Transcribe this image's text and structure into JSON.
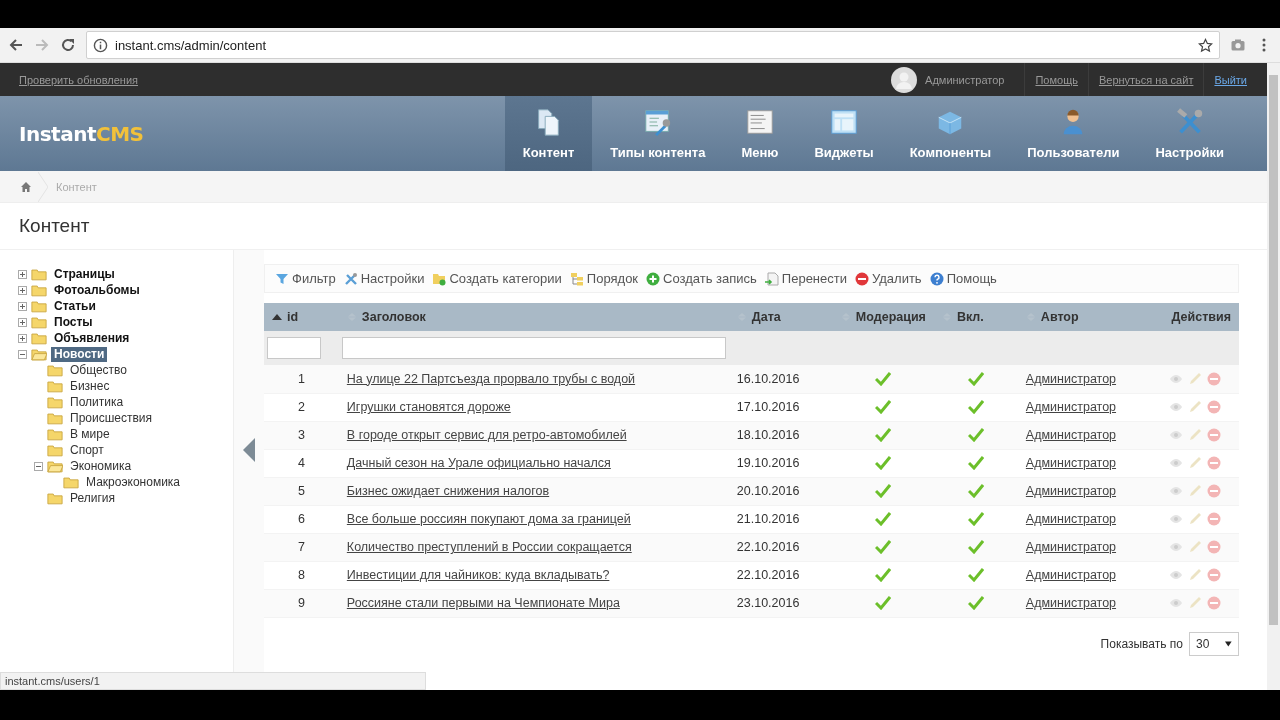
{
  "browser": {
    "url": "instant.cms/admin/content"
  },
  "admin_bar": {
    "update_link": "Проверить обновления",
    "user": "Администратор",
    "links": [
      {
        "label": "Помощь",
        "kind": "plain"
      },
      {
        "label": "Вернуться на сайт",
        "kind": "plain"
      },
      {
        "label": "Выйти",
        "kind": "accent"
      }
    ]
  },
  "header": {
    "logo_part_1": "Instant",
    "logo_part_2": "CMS",
    "nav": [
      {
        "label": "Контент",
        "kind": "content",
        "selected": true
      },
      {
        "label": "Типы контента",
        "kind": "types",
        "selected": false
      },
      {
        "label": "Меню",
        "kind": "menu",
        "selected": false
      },
      {
        "label": "Виджеты",
        "kind": "widgets",
        "selected": false
      },
      {
        "label": "Компоненты",
        "kind": "components",
        "selected": false
      },
      {
        "label": "Пользователи",
        "kind": "users",
        "selected": false
      },
      {
        "label": "Настройки",
        "kind": "settings",
        "selected": false
      }
    ]
  },
  "breadcrumb": [
    "Контент"
  ],
  "page_title": "Контент",
  "tree": [
    {
      "label": "Страницы",
      "expanded": false,
      "selected": false
    },
    {
      "label": "Фотоальбомы",
      "expanded": false,
      "selected": false
    },
    {
      "label": "Статьи",
      "expanded": false,
      "selected": false
    },
    {
      "label": "Посты",
      "expanded": false,
      "selected": false
    },
    {
      "label": "Объявления",
      "expanded": false,
      "selected": false
    },
    {
      "label": "Новости",
      "expanded": true,
      "selected": true,
      "children": [
        {
          "label": "Общество",
          "selected": false
        },
        {
          "label": "Бизнес",
          "selected": false
        },
        {
          "label": "Политика",
          "selected": false
        },
        {
          "label": "Происшествия",
          "selected": false
        },
        {
          "label": "В мире",
          "selected": false
        },
        {
          "label": "Спорт",
          "selected": false
        },
        {
          "label": "Экономика",
          "expanded": true,
          "selected": false,
          "children": [
            {
              "label": "Макроэкономика",
              "selected": false
            }
          ]
        },
        {
          "label": "Религия",
          "selected": false
        }
      ]
    }
  ],
  "toolbar": [
    {
      "label": "Фильтр",
      "kind": "filter"
    },
    {
      "label": "Настройки",
      "kind": "settings"
    },
    {
      "label": "Создать категории",
      "kind": "folder"
    },
    {
      "label": "Порядок",
      "kind": "order"
    },
    {
      "label": "Создать запись",
      "kind": "add"
    },
    {
      "label": "Перенести",
      "kind": "move"
    },
    {
      "label": "Удалить",
      "kind": "delete"
    },
    {
      "label": "Помощь",
      "kind": "help"
    }
  ],
  "table": {
    "columns": [
      {
        "label": "id",
        "sorted": true
      },
      {
        "label": "Заголовок",
        "sorted": false
      },
      {
        "label": "Дата",
        "sorted": false
      },
      {
        "label": "Модерация",
        "sorted": false
      },
      {
        "label": "Вкл.",
        "sorted": false
      },
      {
        "label": "Автор",
        "sorted": false
      },
      {
        "label": "Действия"
      }
    ],
    "rows": [
      {
        "id": "1",
        "title": "На улице 22 Партсъезда прорвало трубы с водой",
        "date": "16.10.2016",
        "moderated": true,
        "enabled": true,
        "author": "Администратор"
      },
      {
        "id": "2",
        "title": "Игрушки становятся дороже",
        "date": "17.10.2016",
        "moderated": true,
        "enabled": true,
        "author": "Администратор"
      },
      {
        "id": "3",
        "title": "В городе открыт сервис для ретро-автомобилей",
        "date": "18.10.2016",
        "moderated": true,
        "enabled": true,
        "author": "Администратор"
      },
      {
        "id": "4",
        "title": "Дачный сезон на Урале официально начался",
        "date": "19.10.2016",
        "moderated": true,
        "enabled": true,
        "author": "Администратор"
      },
      {
        "id": "5",
        "title": "Бизнес ожидает снижения налогов",
        "date": "20.10.2016",
        "moderated": true,
        "enabled": true,
        "author": "Администратор"
      },
      {
        "id": "6",
        "title": "Все больше россиян покупают дома за границей",
        "date": "21.10.2016",
        "moderated": true,
        "enabled": true,
        "author": "Администратор"
      },
      {
        "id": "7",
        "title": "Количество преступлений в России сокращается",
        "date": "22.10.2016",
        "moderated": true,
        "enabled": true,
        "author": "Администратор"
      },
      {
        "id": "8",
        "title": "Инвестиции для чайников: куда вкладывать?",
        "date": "22.10.2016",
        "moderated": true,
        "enabled": true,
        "author": "Администратор"
      },
      {
        "id": "9",
        "title": "Россияне стали первыми на Чемпионате Мира",
        "date": "23.10.2016",
        "moderated": true,
        "enabled": true,
        "author": "Администратор"
      }
    ]
  },
  "pager": {
    "label": "Показывать по",
    "value": "30"
  },
  "status_bar": "instant.cms/users/1"
}
